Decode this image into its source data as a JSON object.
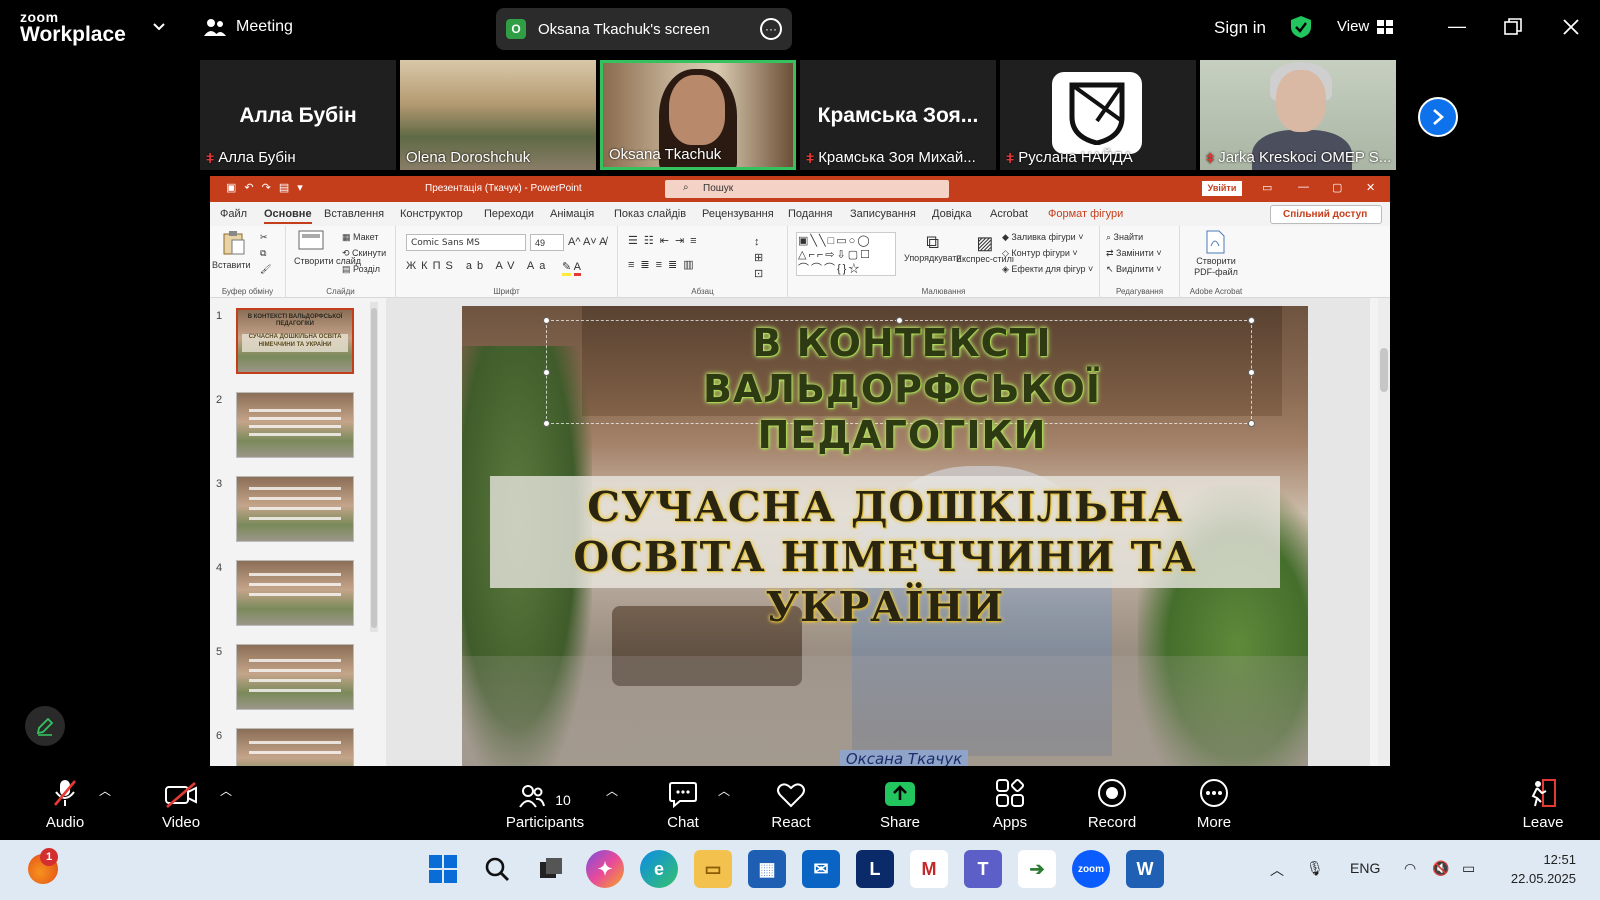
{
  "app": {
    "brand_top": "zoom",
    "brand_bottom": "Workplace",
    "meeting_label": "Meeting",
    "share_badge": "O",
    "share_label": "Oksana Tkachuk's screen",
    "sign_in": "Sign in",
    "view_label": "View"
  },
  "participants": [
    {
      "name": "Алла Бубін",
      "big_name": "Алла Бубін",
      "muted": true,
      "video": false
    },
    {
      "name": "Olena Doroshchuk",
      "muted": false,
      "video": true
    },
    {
      "name": "Oksana Tkachuk",
      "muted": false,
      "video": true,
      "active": true
    },
    {
      "name": "Крамська Зоя Михай...",
      "big_name": "Крамська  Зоя...",
      "muted": true,
      "video": false
    },
    {
      "name": "Руслана НАЙДА",
      "muted": true,
      "video": false
    },
    {
      "name": "Jarka Kreskoci OMEP S...",
      "muted": true,
      "video": true
    }
  ],
  "ppt": {
    "doc_title": "Презентація (Ткачук)  -  PowerPoint",
    "search_placeholder": "Пошук",
    "login": "Увійти",
    "share": "Спільний доступ",
    "tabs": [
      "Файл",
      "Основне",
      "Вставлення",
      "Конструктор",
      "Переходи",
      "Анімація",
      "Показ слайдів",
      "Рецензування",
      "Подання",
      "Записування",
      "Довідка",
      "Acrobat",
      "Формат фігури"
    ],
    "ribbon": {
      "paste": "Вставити",
      "clipboard": "Буфер обміну",
      "new_slide": "Створити слайд",
      "layout": "Макет",
      "reset": "Скинути",
      "section": "Розділ",
      "slides": "Слайди",
      "font_name": "Comic Sans MS",
      "font_size": "49",
      "font_group": "Шрифт",
      "paragraph": "Абзац",
      "arrange": "Упорядкувати",
      "quick_styles": "Експрес-стилі",
      "fill": "Заливка фігури",
      "outline": "Контур фігури",
      "effects": "Ефекти для фігур",
      "drawing": "Малювання",
      "find": "Знайти",
      "replace": "Замінити",
      "select": "Виділити",
      "editing": "Редагування",
      "create_pdf": "Створити PDF-файл",
      "acrobat": "Adobe Acrobat"
    },
    "slide_numbers": [
      "1",
      "2",
      "3",
      "4",
      "5",
      "6"
    ],
    "thumb1_title": "В КОНТЕКСТІ ВАЛЬДОРФСЬКОЇ ПЕДАГОГІКИ",
    "thumb1_sub": "СУЧАСНА ДОШКІЛЬНА ОСВІТА НІМЕЧЧИНИ ТА УКРАЇНИ",
    "slide_title": "В КОНТЕКСТІ ВАЛЬДОРФСЬКОЇ ПЕДАГОГІКИ",
    "slide_subtitle": "СУЧАСНА ДОШКІЛЬНА ОСВІТА НІМЕЧЧИНИ ТА УКРАЇНИ",
    "author": "Оксана Ткачук"
  },
  "toolbar": {
    "audio": "Audio",
    "video": "Video",
    "participants": "Participants",
    "participants_count": "10",
    "chat": "Chat",
    "react": "React",
    "share": "Share",
    "apps": "Apps",
    "record": "Record",
    "more": "More",
    "leave": "Leave"
  },
  "taskbar": {
    "notification_count": "1",
    "lang": "ENG",
    "time": "12:51",
    "date": "22.05.2025"
  },
  "colors": {
    "zoom_blue": "#0e72ed",
    "active_green": "#35c25e",
    "ppt_red": "#c43e1c",
    "share_green": "#22c55e",
    "muted_red": "#e53935"
  }
}
